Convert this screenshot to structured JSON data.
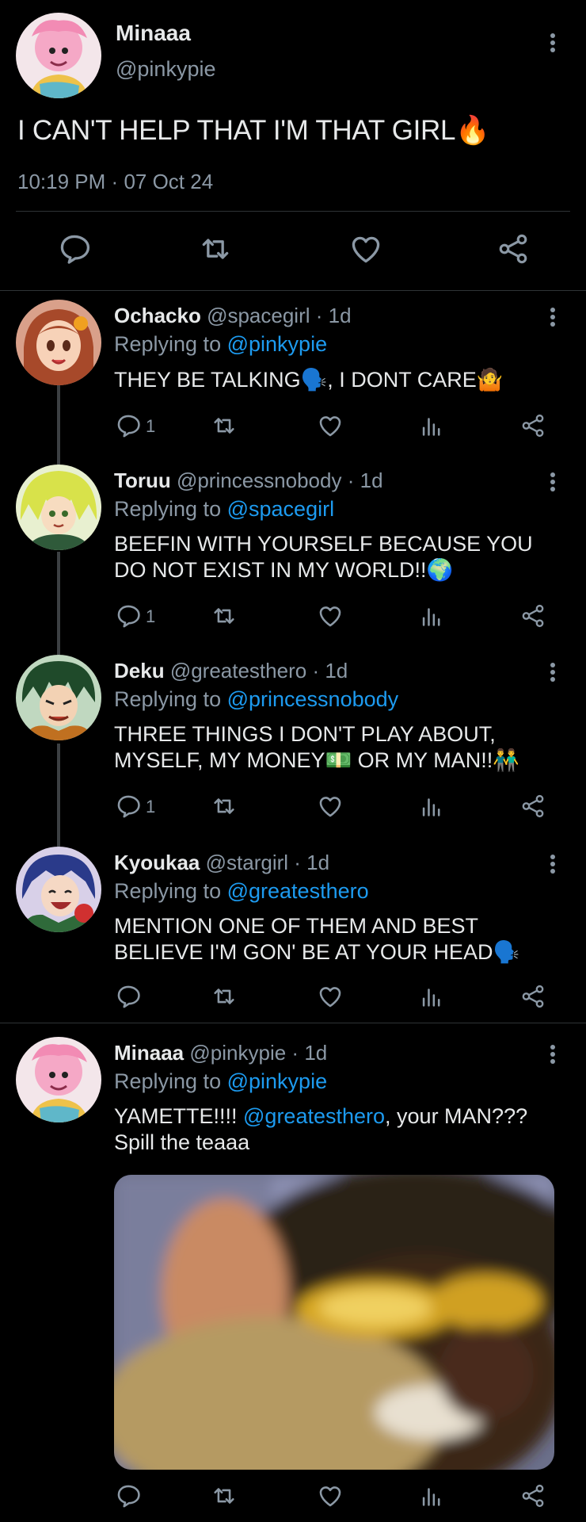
{
  "main_tweet": {
    "display_name": "Minaaa",
    "handle": "@pinkypie",
    "text": "I CAN'T HELP THAT I'M THAT GIRL",
    "emoji": "🔥",
    "time": "10:19 PM",
    "date_sep": "·",
    "date": "07 Oct 24",
    "actions": [
      "reply-icon",
      "retweet-icon",
      "like-icon",
      "share-icon"
    ]
  },
  "replies": [
    {
      "display_name": "Ochacko",
      "handle": "@spacegirl",
      "sep": "·",
      "age": "1d",
      "replying_prefix": "Replying to",
      "replying_to": "@pinkypie",
      "text": "THEY BE TALKING🗣️, I DONT CARE🤷",
      "reply_count": "1"
    },
    {
      "display_name": "Toruu",
      "handle": "@princessnobody",
      "sep": "·",
      "age": "1d",
      "replying_prefix": "Replying to",
      "replying_to": "@spacegirl",
      "text": "BEEFIN WITH YOURSELF BECAUSE YOU DO NOT EXIST IN MY WORLD!!🌍",
      "reply_count": "1"
    },
    {
      "display_name": "Deku",
      "handle": "@greatesthero",
      "sep": "·",
      "age": "1d",
      "replying_prefix": "Replying to",
      "replying_to": "@princessnobody",
      "text": "THREE THINGS I DON'T PLAY ABOUT, MYSELF, MY MONEY💵 OR MY MAN!!👬",
      "reply_count": "1"
    },
    {
      "display_name": "Kyoukaa",
      "handle": "@stargirl",
      "sep": "·",
      "age": "1d",
      "replying_prefix": "Replying to",
      "replying_to": "@greatesthero",
      "text": "MENTION ONE OF THEM AND BEST BELIEVE I'M GON' BE AT YOUR HEAD🗣️",
      "reply_count": ""
    },
    {
      "display_name": "Minaaa",
      "handle": "@pinkypie",
      "sep": "·",
      "age": "1d",
      "replying_prefix": "Replying to",
      "replying_to": "@pinkypie",
      "text_before": "YAMETTE!!!! ",
      "text_mention": "@greatesthero",
      "text_after": ", your MAN??? Spill the teaaa",
      "reply_count": ""
    }
  ],
  "colors": {
    "background": "#000000",
    "text": "#e7e9ea",
    "secondary": "#8b98a5",
    "link": "#1d9bf0",
    "divider": "#2f3336"
  }
}
